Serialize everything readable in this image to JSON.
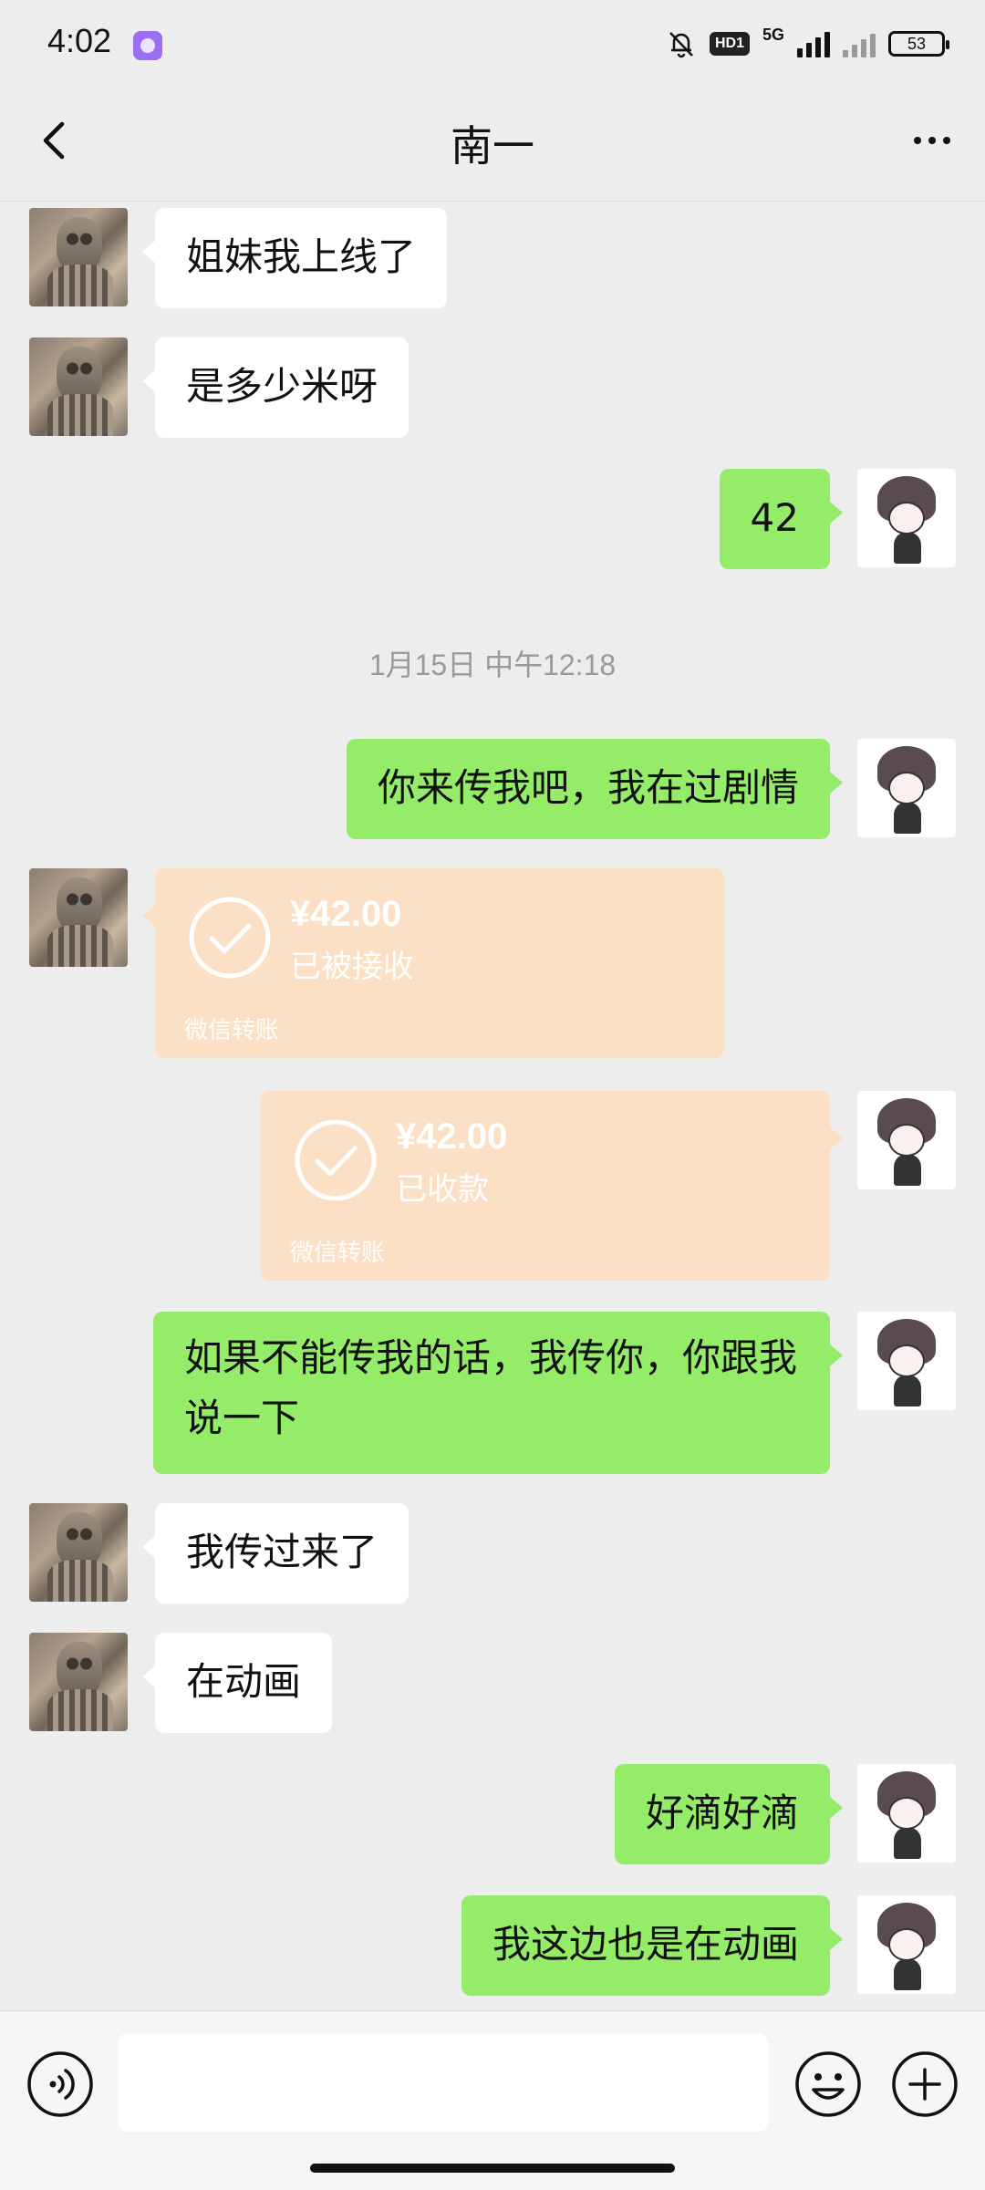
{
  "status_bar": {
    "time": "4:02",
    "network": "5G",
    "hd_badge": "HD1",
    "battery": "53",
    "icons": [
      "app-icon",
      "mute-bell-icon",
      "signal-icon",
      "battery-icon"
    ]
  },
  "header": {
    "title": "南一",
    "back_icon": "chevron-left-icon",
    "more_icon": "more-dots-icon"
  },
  "messages": [
    {
      "side": "in",
      "type": "text",
      "text": "姐妹我上线了"
    },
    {
      "side": "in",
      "type": "text",
      "text": "是多少米呀"
    },
    {
      "side": "out",
      "type": "text",
      "text": "42"
    },
    {
      "type": "time",
      "text": "1月15日 中午12:18"
    },
    {
      "side": "out",
      "type": "text",
      "text": "你来传我吧，我在过剧情"
    },
    {
      "side": "in",
      "type": "transfer",
      "amount": "¥42.00",
      "status": "已被接收",
      "label": "微信转账"
    },
    {
      "side": "out",
      "type": "transfer",
      "amount": "¥42.00",
      "status": "已收款",
      "label": "微信转账"
    },
    {
      "side": "out",
      "type": "text",
      "text": "如果不能传我的话，我传你，你跟我说一下"
    },
    {
      "side": "in",
      "type": "text",
      "text": "我传过来了"
    },
    {
      "side": "in",
      "type": "text",
      "text": "在动画"
    },
    {
      "side": "out",
      "type": "text",
      "text": "好滴好滴"
    },
    {
      "side": "out",
      "type": "text",
      "text": "我这边也是在动画"
    }
  ],
  "input_bar": {
    "value": "",
    "icons": [
      "voice-icon",
      "emoji-icon",
      "plus-icon"
    ]
  },
  "colors": {
    "background": "#ededed",
    "incoming_bubble": "#ffffff",
    "outgoing_bubble": "#95ec69",
    "transfer_card": "#fbe0c5"
  }
}
